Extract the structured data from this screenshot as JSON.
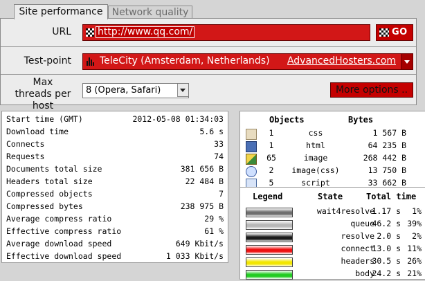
{
  "tabs": [
    {
      "label": "Site performance",
      "active": true
    },
    {
      "label": "Network quality",
      "active": false
    }
  ],
  "form": {
    "url_label": "URL",
    "url_value": "http://www.qq.com/",
    "go_label": "GO",
    "testpoint_label": "Test-point",
    "testpoint_value": "TeleCity (Amsterdam, Netherlands)",
    "testpoint_host": "AdvancedHosters.com",
    "threads_label": "Max threads per host",
    "threads_value": "8 (Opera, Safari)",
    "more_options": "More options .."
  },
  "stats": [
    {
      "key": "Start time (GMT)",
      "value": "2012-05-08 01:34:03"
    },
    {
      "key": "Download time",
      "value": "5.6 s"
    },
    {
      "key": "Connects",
      "value": "33"
    },
    {
      "key": "Requests",
      "value": "74"
    },
    {
      "key": "Documents total size",
      "value": "381 656 B"
    },
    {
      "key": "Headers total size",
      "value": "22 484 B"
    },
    {
      "key": "Compressed objects",
      "value": "7"
    },
    {
      "key": "Compressed bytes",
      "value": "238 975 B"
    },
    {
      "key": "Average compress ratio",
      "value": "29 %"
    },
    {
      "key": "Effective compress ratio",
      "value": "61 %"
    },
    {
      "key": "Average download speed",
      "value": "649 Kbit/s"
    },
    {
      "key": "Effective download speed",
      "value": "1 033 Kbit/s"
    }
  ],
  "objects": {
    "headers": {
      "objects": "Objects",
      "bytes": "Bytes"
    },
    "rows": [
      {
        "icon": "css-file-icon",
        "count": "1",
        "type": "css",
        "bytes": "1 567 B"
      },
      {
        "icon": "html-file-icon",
        "count": "1",
        "type": "html",
        "bytes": "64 235 B"
      },
      {
        "icon": "image-file-icon",
        "count": "65",
        "type": "image",
        "bytes": "268 442 B"
      },
      {
        "icon": "image-css-icon",
        "count": "2",
        "type": "image(css)",
        "bytes": "13 750 B"
      },
      {
        "icon": "script-file-icon",
        "count": "5",
        "type": "script",
        "bytes": "33 662 B"
      }
    ]
  },
  "legend": {
    "headers": {
      "legend": "Legend",
      "state": "State",
      "total": "Total time"
    },
    "rows": [
      {
        "state": "wait4resolve",
        "time": "1.17 s",
        "pct": "1%",
        "color": "#6e6e6e"
      },
      {
        "state": "queue",
        "time": "46.2 s",
        "pct": "39%",
        "color": "#b8b8b8"
      },
      {
        "state": "resolve",
        "time": "2.0 s",
        "pct": "2%",
        "color": "#1a1a1a"
      },
      {
        "state": "connect",
        "time": "13.0 s",
        "pct": "11%",
        "color": "#ee1111"
      },
      {
        "state": "headers",
        "time": "30.5 s",
        "pct": "26%",
        "color": "#f2e600"
      },
      {
        "state": "body",
        "time": "24.2 s",
        "pct": "21%",
        "color": "#22cc22"
      }
    ]
  }
}
